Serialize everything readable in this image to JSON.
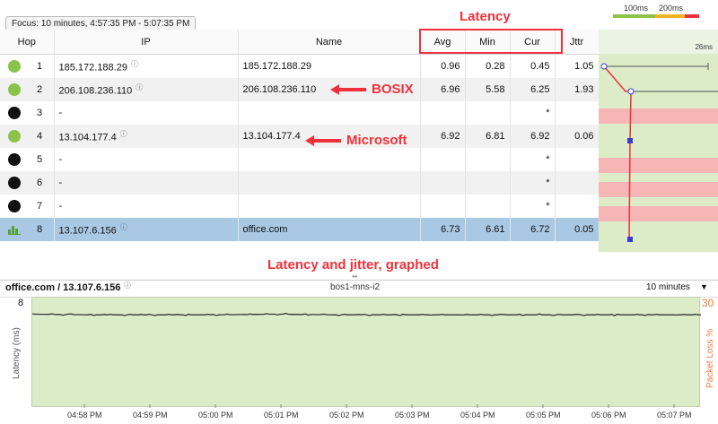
{
  "focus_label": "Focus: 10 minutes, 4:57:35 PM - 5:07:35 PM",
  "scale": {
    "a": "100ms",
    "b": "200ms",
    "colors": [
      "#8bc34a",
      "#f5b323",
      "#f0313a"
    ]
  },
  "annotations": {
    "latency": "Latency",
    "bosix": "BOSIX",
    "microsoft": "Microsoft",
    "graphed": "Latency and jitter, graphed"
  },
  "columns": {
    "hop": "Hop",
    "ip": "IP",
    "name": "Name",
    "avg": "Avg",
    "min": "Min",
    "cur": "Cur",
    "jitter": "Jttr",
    "max_ms": "26ms"
  },
  "hops": [
    {
      "hop": "1",
      "status": "green",
      "ip": "185.172.188.29",
      "info": "ⓘ",
      "name": "185.172.188.29",
      "avg": "0.96",
      "min": "0.28",
      "cur": "0.45",
      "jitter": "1.05"
    },
    {
      "hop": "2",
      "status": "green",
      "ip": "206.108.236.110",
      "info": "ⓘ",
      "name": "206.108.236.110",
      "avg": "6.96",
      "min": "5.58",
      "cur": "6.25",
      "jitter": "1.93"
    },
    {
      "hop": "3",
      "status": "black",
      "ip": "-",
      "info": "",
      "name": "",
      "avg": "",
      "min": "",
      "cur": "*",
      "jitter": ""
    },
    {
      "hop": "4",
      "status": "green",
      "ip": "13.104.177.4",
      "info": "ⓘ",
      "name": "13.104.177.4",
      "avg": "6.92",
      "min": "6.81",
      "cur": "6.92",
      "jitter": "0.06"
    },
    {
      "hop": "5",
      "status": "black",
      "ip": "-",
      "info": "",
      "name": "",
      "avg": "",
      "min": "",
      "cur": "*",
      "jitter": ""
    },
    {
      "hop": "6",
      "status": "black",
      "ip": "-",
      "info": "",
      "name": "",
      "avg": "",
      "min": "",
      "cur": "*",
      "jitter": ""
    },
    {
      "hop": "7",
      "status": "black",
      "ip": "-",
      "info": "",
      "name": "",
      "avg": "",
      "min": "",
      "cur": "*",
      "jitter": ""
    },
    {
      "hop": "8",
      "status": "chart",
      "ip": "13.107.6.156",
      "info": "ⓘ",
      "name": "office.com",
      "avg": "6.73",
      "min": "6.61",
      "cur": "6.72",
      "jitter": "0.05"
    }
  ],
  "lower": {
    "target": "office.com / 13.107.6.156",
    "info": "ⓘ",
    "agent": "bos1-mns-i2",
    "range": "10 minutes",
    "caret": "▼",
    "y_max": "8",
    "y2_max": "30",
    "y_label": "Latency (ms)",
    "y2_label": "Packet Loss %",
    "grip": "•••",
    "x_ticks": [
      "04:58 PM",
      "04:59 PM",
      "05:00 PM",
      "05:01 PM",
      "05:02 PM",
      "05:03 PM",
      "05:04 PM",
      "05:05 PM",
      "05:06 PM",
      "05:07 PM"
    ]
  },
  "chart_data": {
    "type": "line",
    "x": [
      "04:57:35 PM",
      "04:58 PM",
      "04:59 PM",
      "05:00 PM",
      "05:01 PM",
      "05:02 PM",
      "05:03 PM",
      "05:04 PM",
      "05:05 PM",
      "05:06 PM",
      "05:07 PM",
      "05:07:35 PM"
    ],
    "series": [
      {
        "values": [
          6.8,
          6.75,
          6.75,
          6.75,
          6.8,
          6.75,
          6.75,
          6.75,
          6.75,
          6.75,
          6.75,
          6.75
        ]
      }
    ],
    "ylabel": "Latency (ms)",
    "y2label": "Packet Loss %",
    "ylim": [
      0,
      8
    ],
    "y2lim": [
      0,
      30
    ],
    "colors": {
      "line": "#333333",
      "background": "#dcecc9",
      "loss_axis": "#f07a3a"
    }
  }
}
